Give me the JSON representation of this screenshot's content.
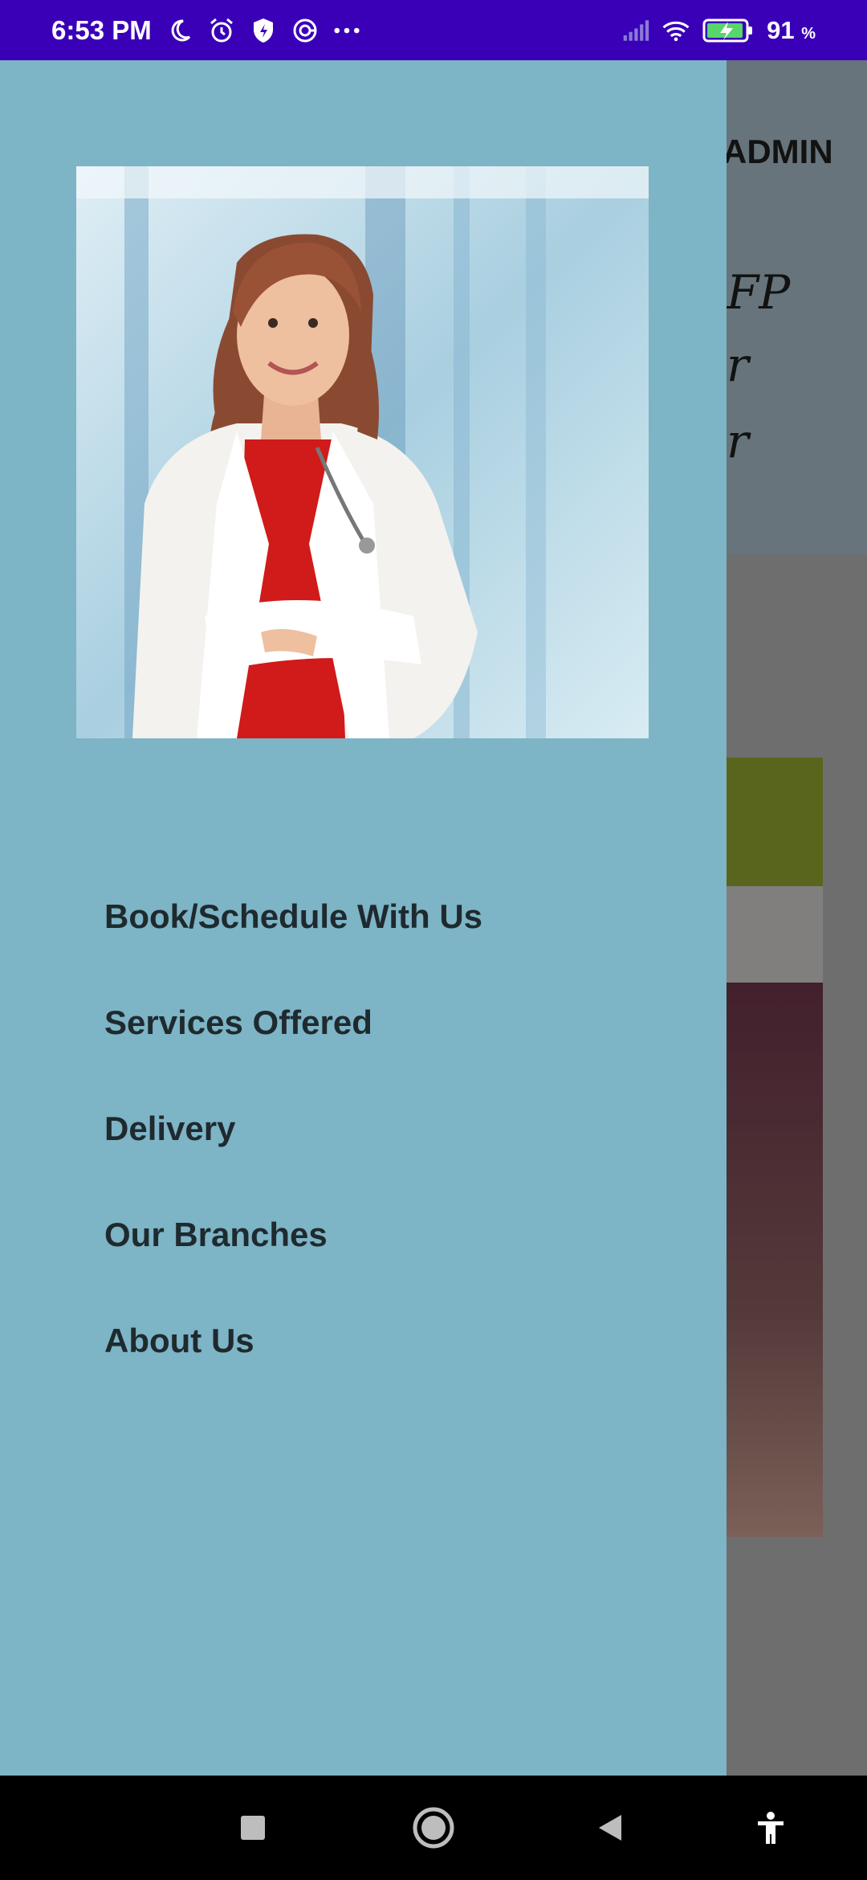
{
  "status_bar": {
    "time": "6:53 PM",
    "icons_left": [
      "moon-icon",
      "alarm-icon",
      "shield-icon",
      "vpn-icon",
      "more-dots-icon"
    ],
    "battery_percent": "91",
    "battery_unit": "%",
    "icons_right": [
      "signal-icon",
      "wifi-icon",
      "battery-charging-icon"
    ]
  },
  "background_app": {
    "header_text": "ADMIN",
    "lines": [
      "FP",
      "r",
      "r"
    ]
  },
  "drawer": {
    "profile_image": "doctor-portrait",
    "menu": [
      {
        "label": "Book/Schedule With Us"
      },
      {
        "label": "Services Offered"
      },
      {
        "label": "Delivery"
      },
      {
        "label": "Our Branches"
      },
      {
        "label": "About Us"
      }
    ]
  },
  "nav_bar": {
    "buttons": [
      "recents-button",
      "home-button",
      "back-button",
      "accessibility-button"
    ]
  },
  "colors": {
    "status_bar": "#3a00b8",
    "drawer": "#7db4c6",
    "menu_text": "#1f2a2e"
  }
}
